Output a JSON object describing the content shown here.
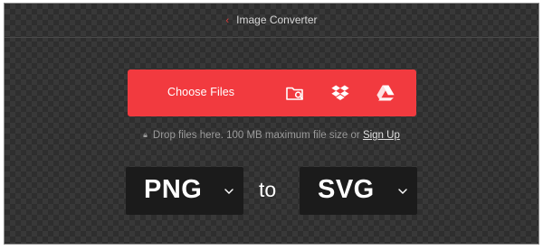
{
  "header": {
    "back_glyph": "‹",
    "title": "Image Converter"
  },
  "upload": {
    "choose_label": "Choose Files",
    "icons": [
      "folder-search-icon",
      "dropbox-icon",
      "google-drive-icon"
    ],
    "accent": "#f23a3f"
  },
  "hint": {
    "text": "Drop files here. 100 MB maximum file size or",
    "signup_label": "Sign Up"
  },
  "converter": {
    "from_format": "PNG",
    "connector": "to",
    "to_format": "SVG"
  },
  "colors": {
    "background": "#323232",
    "format_box": "#1b1b1b"
  }
}
